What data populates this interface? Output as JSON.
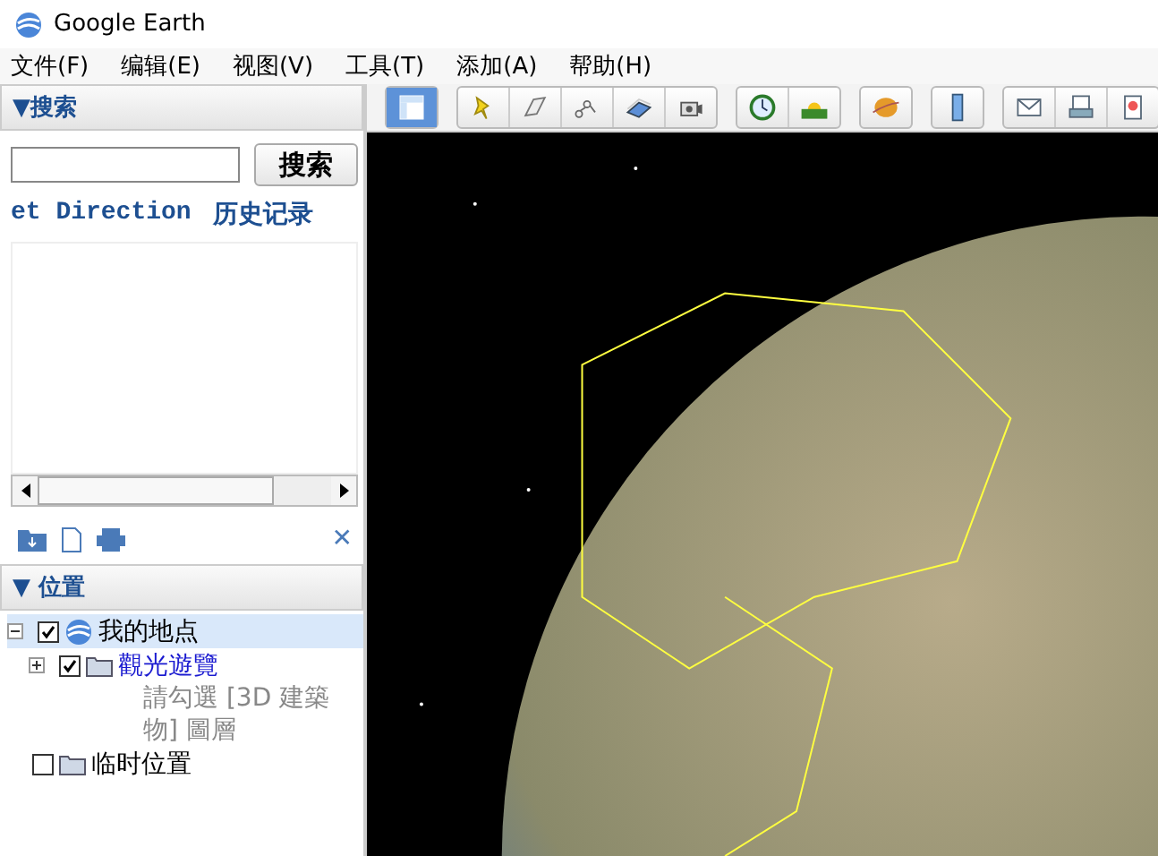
{
  "window": {
    "title": "Google Earth"
  },
  "menu": [
    "文件(F)",
    "编辑(E)",
    "视图(V)",
    "工具(T)",
    "添加(A)",
    "帮助(H)"
  ],
  "search_panel": {
    "header": "▼搜索",
    "button": "搜索",
    "tabs": [
      {
        "label": "et Direction",
        "selected": false
      },
      {
        "label": "历史记录",
        "selected": false
      }
    ]
  },
  "places_panel": {
    "header": "▼ 位置",
    "close": "✕",
    "tree": [
      {
        "label": "我的地点",
        "checked": true,
        "selected": true,
        "expanded": true,
        "kind": "globe",
        "children": [
          {
            "label": "觀光遊覽",
            "checked": true,
            "selected": false,
            "expanded": false,
            "kind": "folder",
            "link": true,
            "description": "請勾選 [3D 建築物] 圖層"
          }
        ]
      },
      {
        "label": "临时位置",
        "checked": false,
        "selected": false,
        "kind": "folder"
      }
    ]
  },
  "toolbar": [
    [
      {
        "selected": true
      }
    ],
    [
      {
        "selected": false
      },
      {
        "selected": false
      },
      {
        "selected": false
      },
      {
        "selected": false
      },
      {
        "selected": false
      }
    ],
    [
      {
        "selected": false
      },
      {
        "selected": false
      }
    ],
    [
      {
        "selected": false
      }
    ],
    [
      {
        "selected": false
      }
    ],
    [
      {
        "selected": false
      },
      {
        "selected": false
      },
      {
        "selected": false
      }
    ]
  ]
}
